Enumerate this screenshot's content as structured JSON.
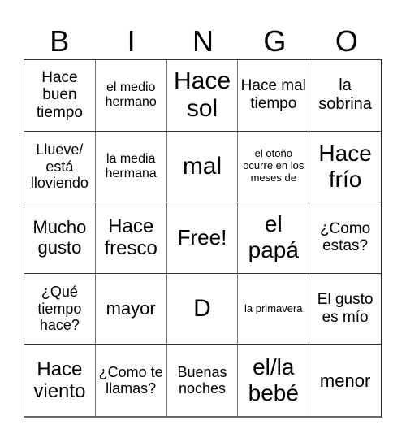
{
  "header": {
    "letters": [
      "B",
      "I",
      "N",
      "G",
      "O"
    ]
  },
  "cells": [
    "Hace buen tiempo",
    "el medio hermano",
    "Hace sol",
    "Hace mal tiempo",
    "la sobrina",
    "Llueve/ está lloviendo",
    "la media hermana",
    "mal",
    "el otoño ocurre en los meses de",
    "Hace frío",
    "Mucho gusto",
    "Hace fresco",
    "Free!",
    "el papá",
    "¿Como estas?",
    "¿Qué tiempo hace?",
    "mayor",
    "D",
    "la primavera",
    "El gusto es mío",
    "Hace viento",
    "¿Como te llamas?",
    "Buenas noches",
    "el/la bebé",
    "menor"
  ]
}
